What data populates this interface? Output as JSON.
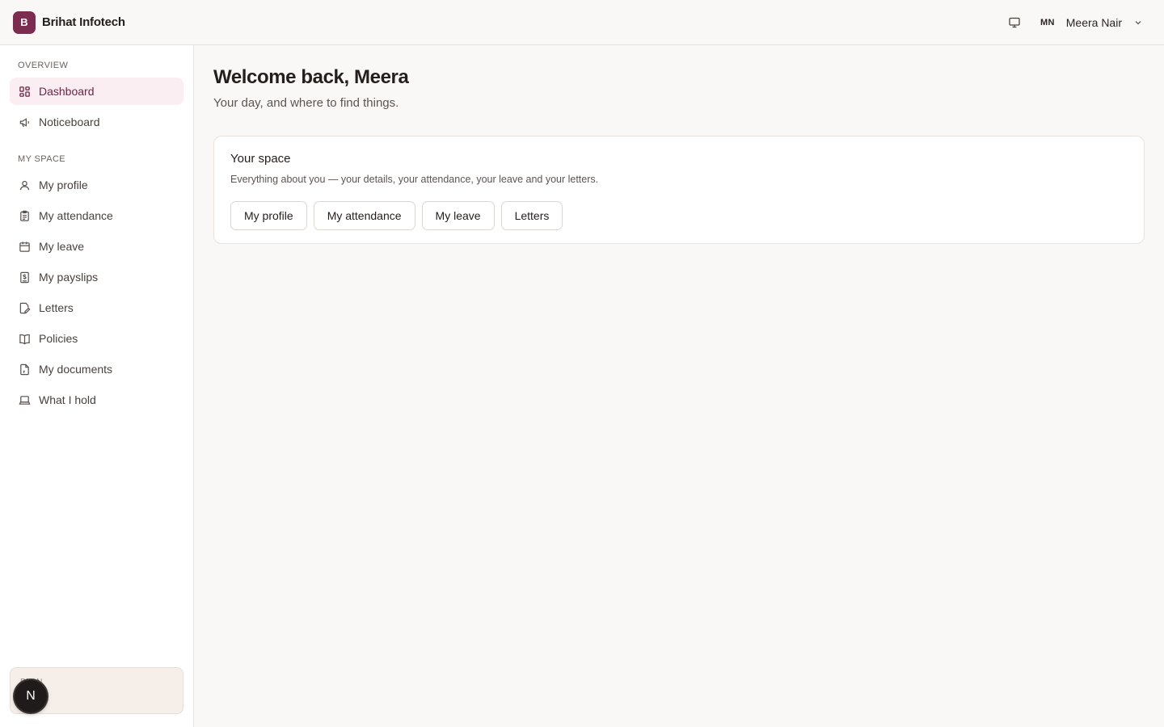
{
  "brand": {
    "logo_letter": "B",
    "name": "Brihat Infotech",
    "accent": "#7c2d4f"
  },
  "user": {
    "initials": "MN",
    "name": "Meera Nair"
  },
  "sidebar": {
    "sections": [
      {
        "label": "OVERVIEW",
        "items": [
          {
            "label": "Dashboard",
            "icon": "dashboard-grid-icon",
            "active": true
          },
          {
            "label": "Noticeboard",
            "icon": "megaphone-icon",
            "active": false
          }
        ]
      },
      {
        "label": "MY SPACE",
        "items": [
          {
            "label": "My profile",
            "icon": "user-icon"
          },
          {
            "label": "My attendance",
            "icon": "clipboard-icon"
          },
          {
            "label": "My leave",
            "icon": "calendar-icon"
          },
          {
            "label": "My payslips",
            "icon": "payslip-icon"
          },
          {
            "label": "Letters",
            "icon": "letter-edit-icon"
          },
          {
            "label": "Policies",
            "icon": "book-icon"
          },
          {
            "label": "My documents",
            "icon": "document-icon"
          },
          {
            "label": "What I hold",
            "icon": "laptop-icon"
          }
        ]
      }
    ],
    "plan_label": "PLAN",
    "badge_letter": "N"
  },
  "main": {
    "welcome": "Welcome back, Meera",
    "subtitle": "Your day, and where to find things.",
    "card": {
      "title": "Your space",
      "description": "Everything about you — your details, your attendance, your leave and your letters.",
      "buttons": [
        "My profile",
        "My attendance",
        "My leave",
        "Letters"
      ]
    }
  }
}
